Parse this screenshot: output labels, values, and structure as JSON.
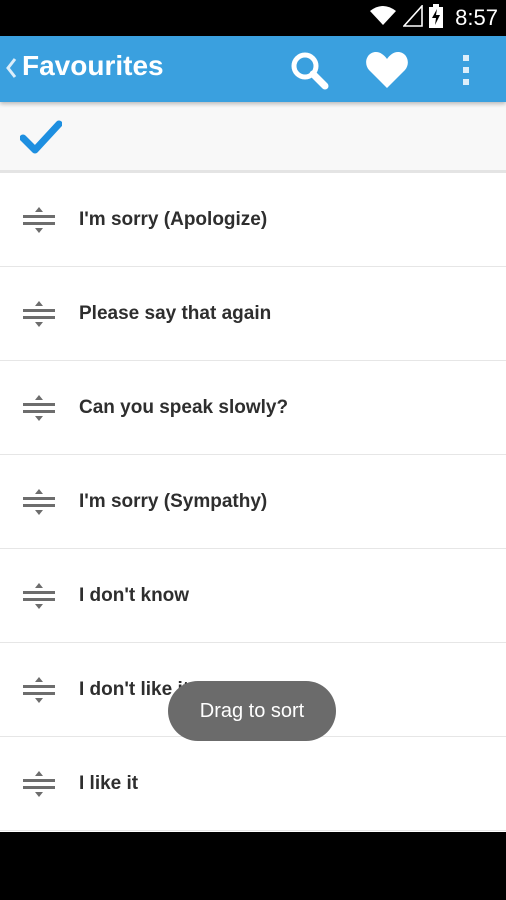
{
  "status_bar": {
    "time": "8:57",
    "icons": [
      "wifi-icon",
      "signal-icon",
      "battery-charging-icon"
    ]
  },
  "app_bar": {
    "title": "Favourites",
    "background": "#3aa0df",
    "actions": [
      "search-icon",
      "heart-icon",
      "overflow-menu-icon"
    ]
  },
  "favourites": {
    "items": [
      {
        "label": "I'm sorry (Apologize)"
      },
      {
        "label": "Please say that again"
      },
      {
        "label": "Can you speak slowly?"
      },
      {
        "label": "I'm sorry (Sympathy)"
      },
      {
        "label": "I don't know"
      },
      {
        "label": "I don't like it"
      },
      {
        "label": "I like it"
      }
    ]
  },
  "toast": {
    "message": "Drag to sort"
  },
  "colors": {
    "accent": "#3aa0df",
    "check": "#1e8fe0",
    "item_text": "#2e2e2e"
  }
}
